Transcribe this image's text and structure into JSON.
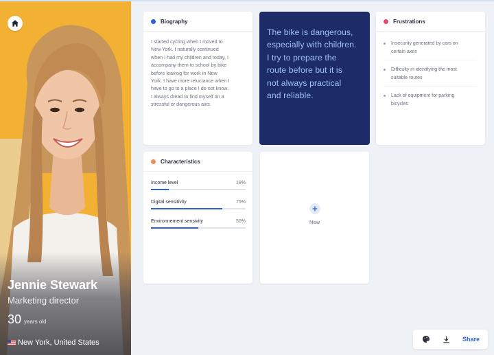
{
  "profile": {
    "name": "Jennie Stewark",
    "role": "Marketing director",
    "age": "30",
    "age_unit": "years old",
    "location": "New York, United States"
  },
  "biography": {
    "title": "Biography",
    "lines": [
      "I started cycling when I moved to",
      "New York. I naturally continued",
      "when I had my children and today, I",
      "accompany them to school by bike",
      "before leaving for work in New",
      "York. I have more reluctance when I",
      "have to go to a place I do not know.",
      "I always dread to find myself on a",
      "stressful or dangerous axis."
    ],
    "dot_color": "#2b62d9"
  },
  "quote": {
    "lines": [
      "The bike is dangerous,",
      "especially with children.",
      "I try to prepare the",
      "route before but it is",
      "not always practical",
      "and reliable."
    ]
  },
  "frustrations": {
    "title": "Frustrations",
    "dot_color": "#e8476b",
    "items": [
      {
        "lines": [
          "Insecurity generated by cars on",
          "certain axes"
        ]
      },
      {
        "lines": [
          "Difficulty in identifying the most",
          "suitable routes"
        ]
      },
      {
        "lines": [
          "Lack of equipment for parking",
          "bicycles"
        ]
      }
    ]
  },
  "characteristics": {
    "title": "Characteristics",
    "dot_color": "#ef8a5a",
    "items": [
      {
        "label": "Income level",
        "percent_text": "19%",
        "value": 0.19
      },
      {
        "label": "Digital sensitivity",
        "percent_text": "75%",
        "value": 0.75
      },
      {
        "label": "Environnement sensivity",
        "percent_text": "50%",
        "value": 0.5
      }
    ]
  },
  "new_card": {
    "label": "New"
  },
  "toolbar": {
    "share_label": "Share"
  },
  "icons": {
    "home": "home-icon",
    "palette": "palette-icon",
    "download": "download-icon",
    "plus": "plus-icon",
    "flag": "us-flag-icon"
  },
  "colors": {
    "accent": "#2b62d9",
    "quote_bg": "#1d2b68",
    "quote_text": "#9fc3f4",
    "profile_bg": "#f2b133"
  }
}
